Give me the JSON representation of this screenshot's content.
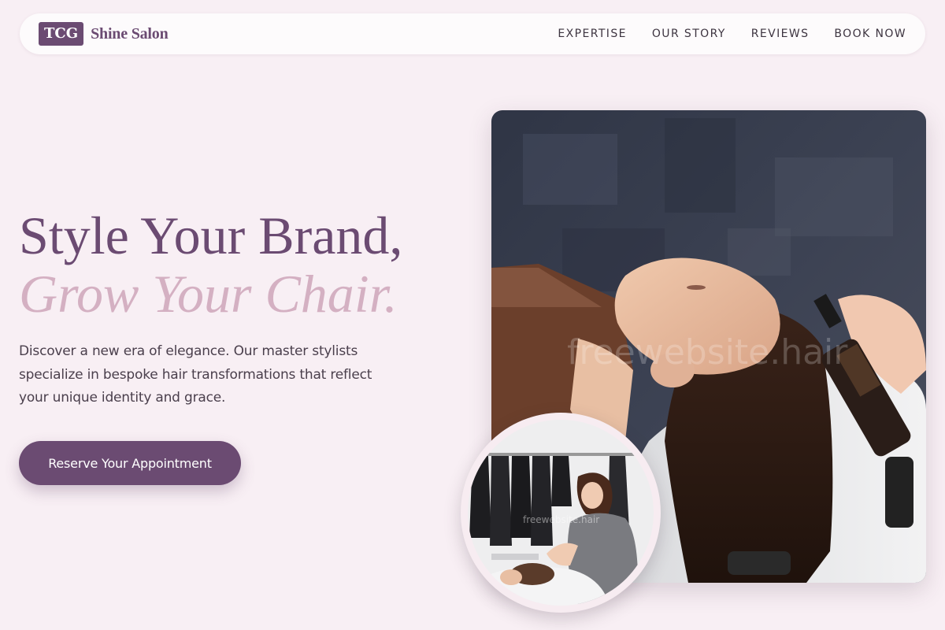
{
  "nav": {
    "logo_mark": "TCG",
    "brand_name": "Shine Salon",
    "links": [
      {
        "label": "EXPERTISE"
      },
      {
        "label": "OUR STORY"
      },
      {
        "label": "REVIEWS"
      },
      {
        "label": "BOOK NOW"
      }
    ]
  },
  "hero": {
    "title_line1": "Style Your Brand,",
    "title_line2": "Grow Your Chair.",
    "description": "Discover a new era of elegance. Our master stylists specialize in bespoke hair transformations that reflect your unique identity and grace.",
    "cta_label": "Reserve Your Appointment"
  },
  "images": {
    "main_watermark": "freewebsite.hair",
    "circle_watermark": "freewebsite.hair"
  },
  "colors": {
    "background": "#f8eff4",
    "accent": "#6b4b72",
    "accent_light": "#d4b0c2",
    "nav_bg": "#fdfbfc"
  }
}
